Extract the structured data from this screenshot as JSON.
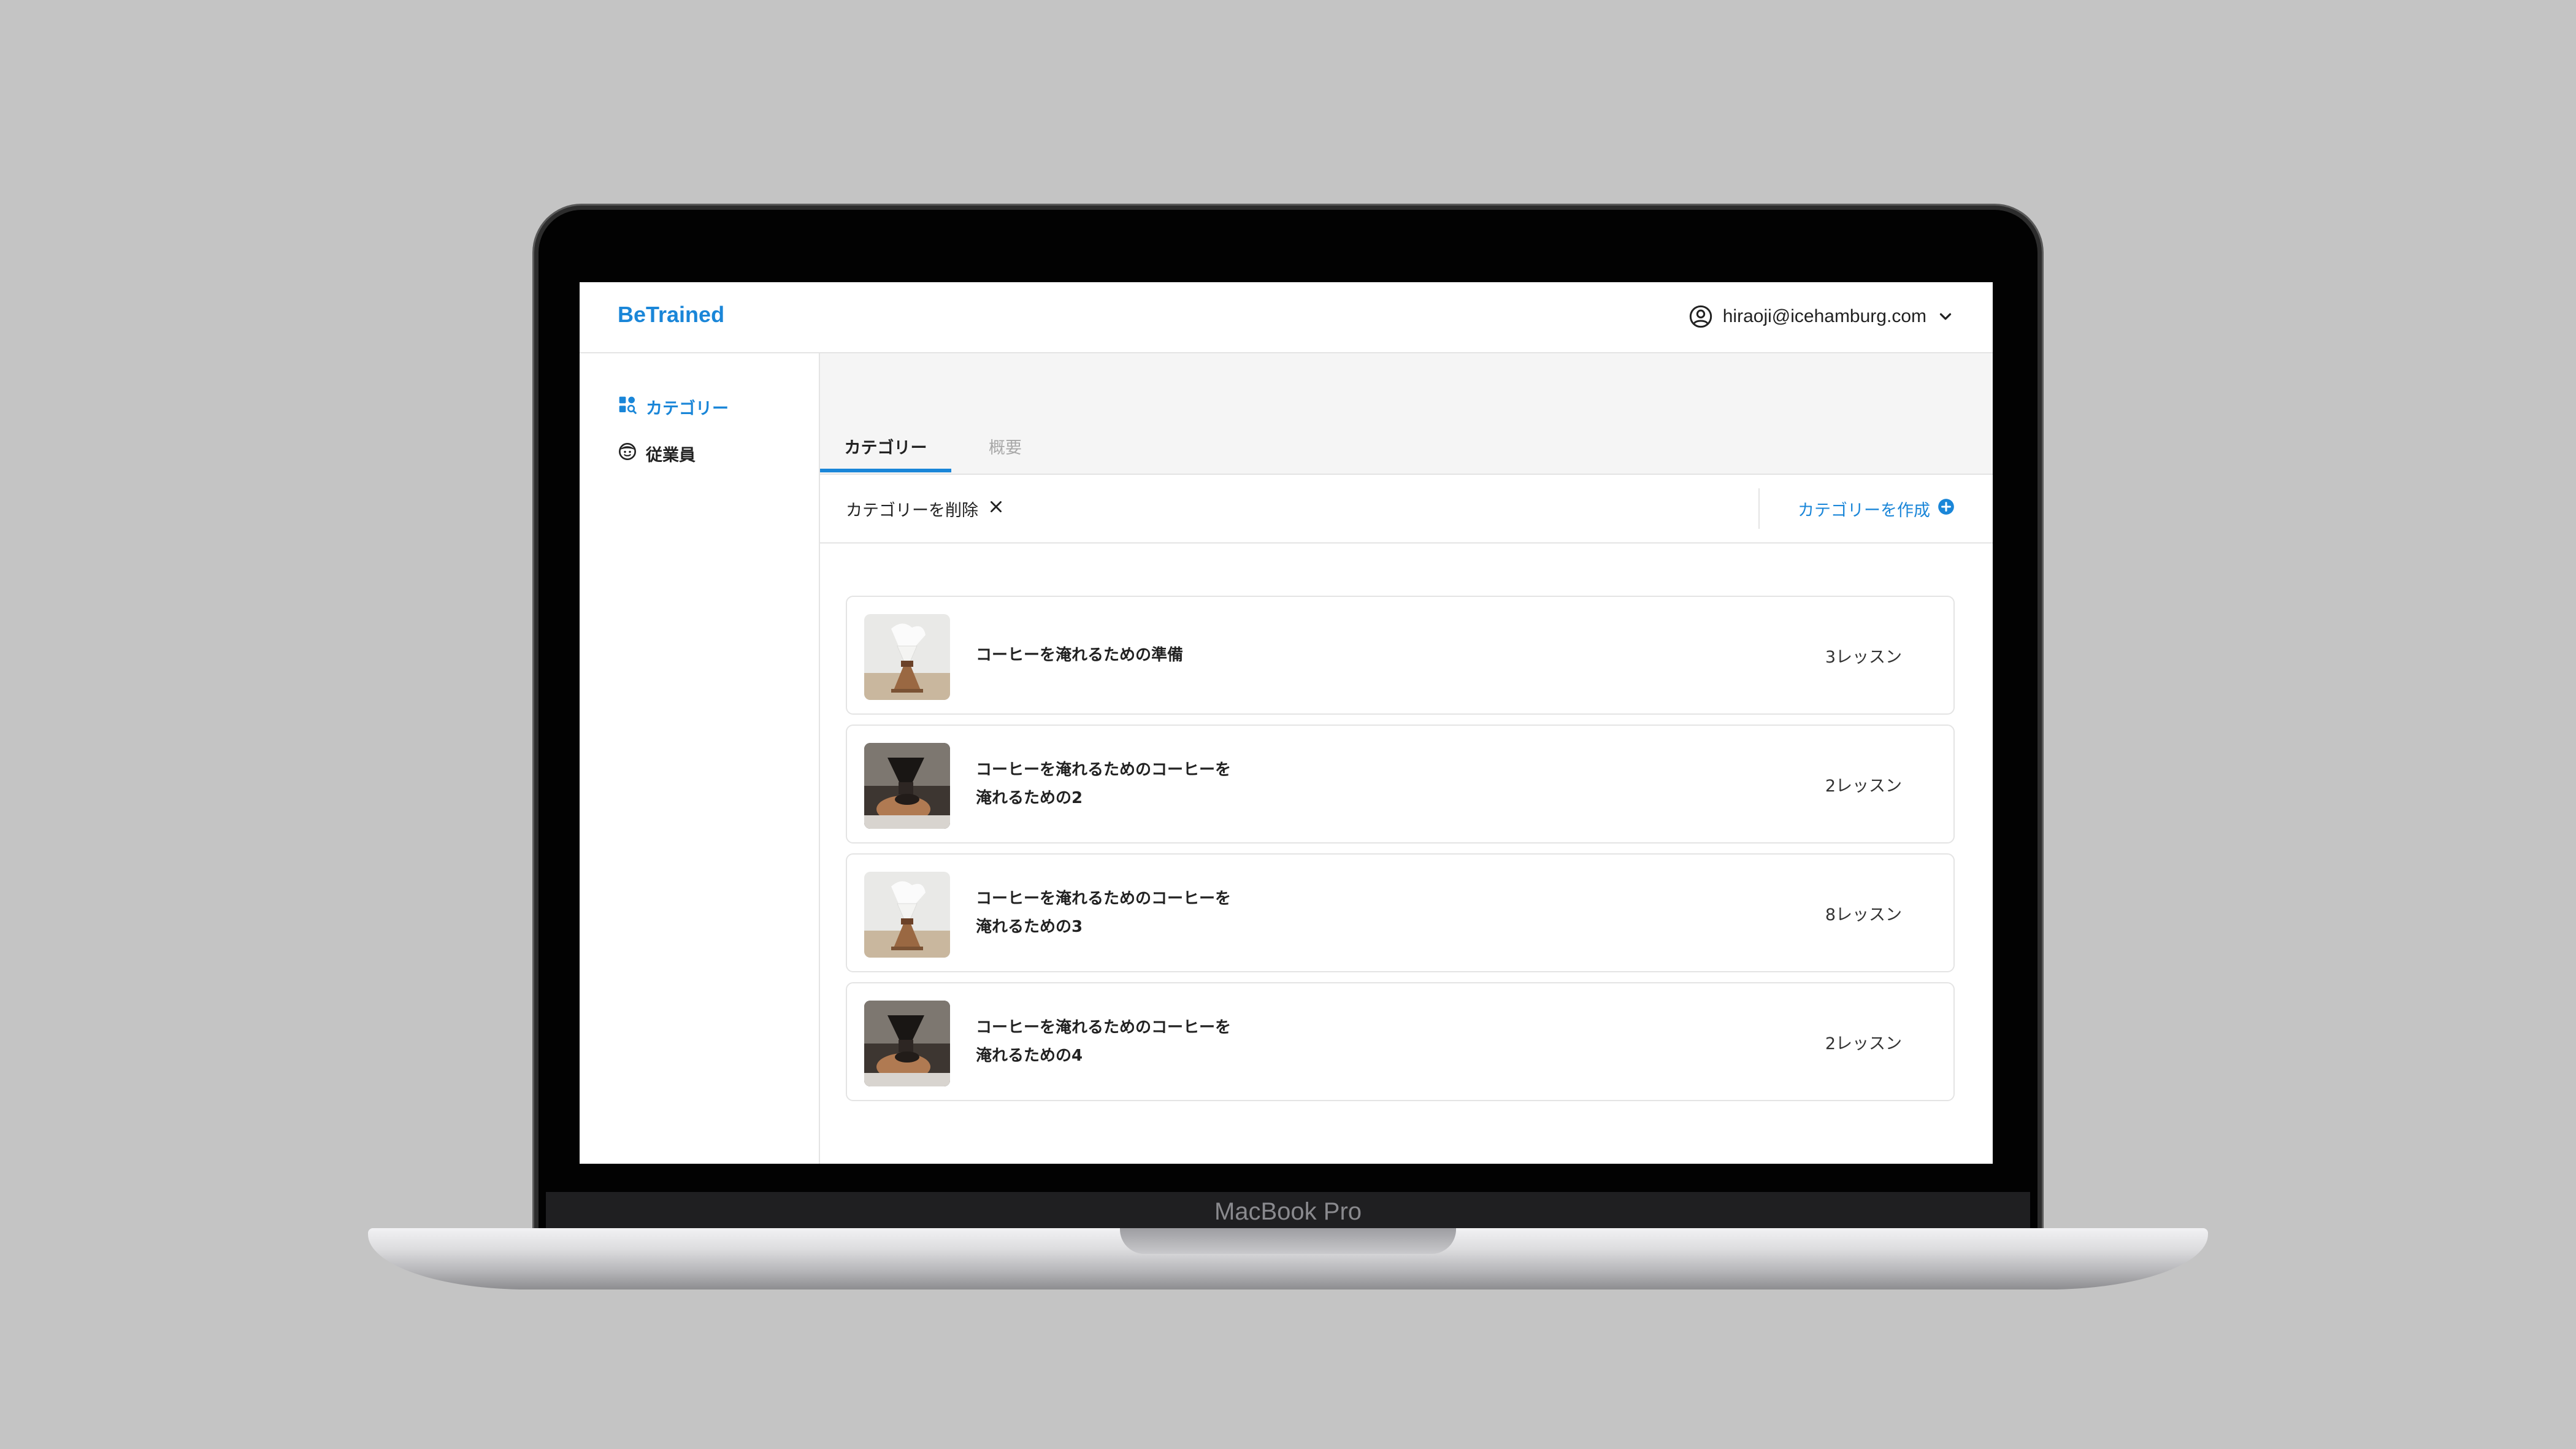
{
  "device": {
    "label": "MacBook Pro"
  },
  "header": {
    "brand": "BeTrained",
    "user_email": "hiraoji@icehamburg.com"
  },
  "sidebar": {
    "items": [
      {
        "label": "カテゴリー",
        "icon": "category-icon",
        "active": true
      },
      {
        "label": "従業員",
        "icon": "employee-icon",
        "active": false
      }
    ]
  },
  "tabs": [
    {
      "label": "カテゴリー",
      "active": true
    },
    {
      "label": "概要",
      "active": false
    }
  ],
  "actions": {
    "delete_label": "カテゴリーを削除",
    "create_label": "カテゴリーを作成"
  },
  "categories": [
    {
      "title": "コーヒーを淹れるための準備",
      "count": "3レッスン",
      "thumb": "light"
    },
    {
      "title": "コーヒーを淹れるためのコーヒーを\n淹れるための2",
      "count": "2レッスン",
      "thumb": "dark"
    },
    {
      "title": "コーヒーを淹れるためのコーヒーを\n淹れるための3",
      "count": "8レッスン",
      "thumb": "light"
    },
    {
      "title": "コーヒーを淹れるためのコーヒーを\n淹れるための4",
      "count": "2レッスン",
      "thumb": "dark"
    }
  ],
  "colors": {
    "accent": "#1a86d8",
    "text": "#222222",
    "border": "#e4e4e4",
    "background": "#c4c4c4"
  }
}
